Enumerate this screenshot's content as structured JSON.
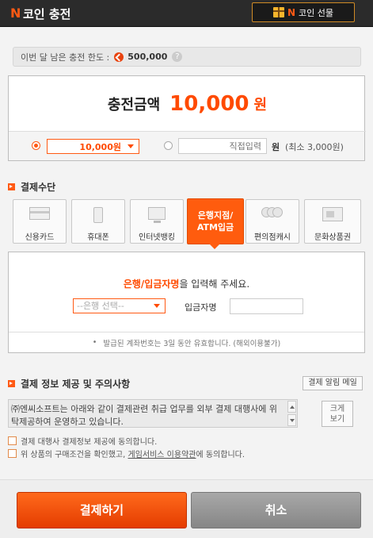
{
  "header": {
    "brand_letter": "N",
    "title": "코인 충전",
    "gift_letter": "N",
    "gift_label": "코인 선물"
  },
  "limit": {
    "label": "이번 달 남은 충전 한도 :",
    "value": "500,000",
    "help": "?"
  },
  "charge": {
    "label": "충전금액",
    "amount": "10,000",
    "currency": "원",
    "selected_amount": "10,000원",
    "direct_placeholder": "직접입력",
    "unit": "원",
    "min_note": "(최소 3,000원)"
  },
  "payment": {
    "heading": "결제수단",
    "methods": [
      {
        "label": "신용카드",
        "icon": "credit-card-icon"
      },
      {
        "label": "휴대폰",
        "icon": "mobile-phone-icon"
      },
      {
        "label": "인터넷뱅킹",
        "icon": "monitor-icon"
      },
      {
        "label": "은행지점/\nATM입금",
        "icon": "bank-icon",
        "active": true
      },
      {
        "label": "편의점캐시",
        "icon": "coins-icon"
      },
      {
        "label": "문화상품권",
        "icon": "voucher-icon"
      }
    ]
  },
  "bank": {
    "guide_bold": "은행/입금자명",
    "guide_rest": "을 입력해 주세요.",
    "select_placeholder": "--은행 선택--",
    "depositor_label": "입금자명",
    "note": "발급된 계좌번호는 3일 동안 유효합니다. (해외이용불가)"
  },
  "info": {
    "heading": "결제 정보 제공 및 주의사항",
    "alert_button": "결제 알림 메일",
    "terms_text": "㈜엔씨소프트는 아래와 같이 결제관련 취급 업무를 외부 결제 대행사에 위탁제공하여 운영하고 있습니다.",
    "expand_button": "크게\n보기",
    "agree1": "결제 대행사 결제정보 제공에 동의합니다.",
    "agree2_pre": "위 상품의 구매조건을 확인했고, ",
    "agree2_link": "게임서비스 이용약관",
    "agree2_post": "에 동의합니다."
  },
  "actions": {
    "pay": "결제하기",
    "cancel": "취소"
  },
  "colors": {
    "accent": "#ff5a14",
    "header_bg": "#2b2b2b"
  }
}
